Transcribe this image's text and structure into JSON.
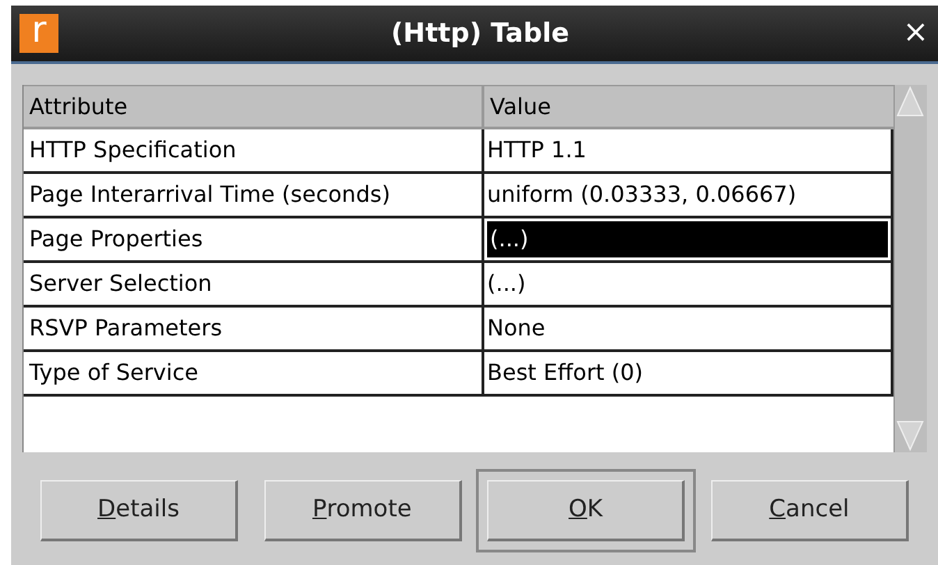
{
  "window": {
    "title": "(Http) Table",
    "app_icon_letter": "r",
    "close": "×"
  },
  "table": {
    "columns": [
      "Attribute",
      "Value"
    ],
    "rows": [
      {
        "attribute": "HTTP Specification",
        "value": "HTTP 1.1",
        "selected": false
      },
      {
        "attribute": "Page Interarrival Time (seconds)",
        "value": "uniform (0.03333, 0.06667)",
        "selected": false
      },
      {
        "attribute": "Page Properties",
        "value": "(...)",
        "selected": true
      },
      {
        "attribute": "Server Selection",
        "value": "(...)",
        "selected": false
      },
      {
        "attribute": "RSVP Parameters",
        "value": "None",
        "selected": false
      },
      {
        "attribute": "Type of Service",
        "value": "Best Effort (0)",
        "selected": false
      }
    ]
  },
  "buttons": [
    {
      "underlined": "D",
      "rest": "etails",
      "default": false
    },
    {
      "underlined": "P",
      "rest": "romote",
      "default": false
    },
    {
      "underlined": "O",
      "rest": "K",
      "default": true
    },
    {
      "underlined": "C",
      "rest": "ancel",
      "default": false
    }
  ]
}
